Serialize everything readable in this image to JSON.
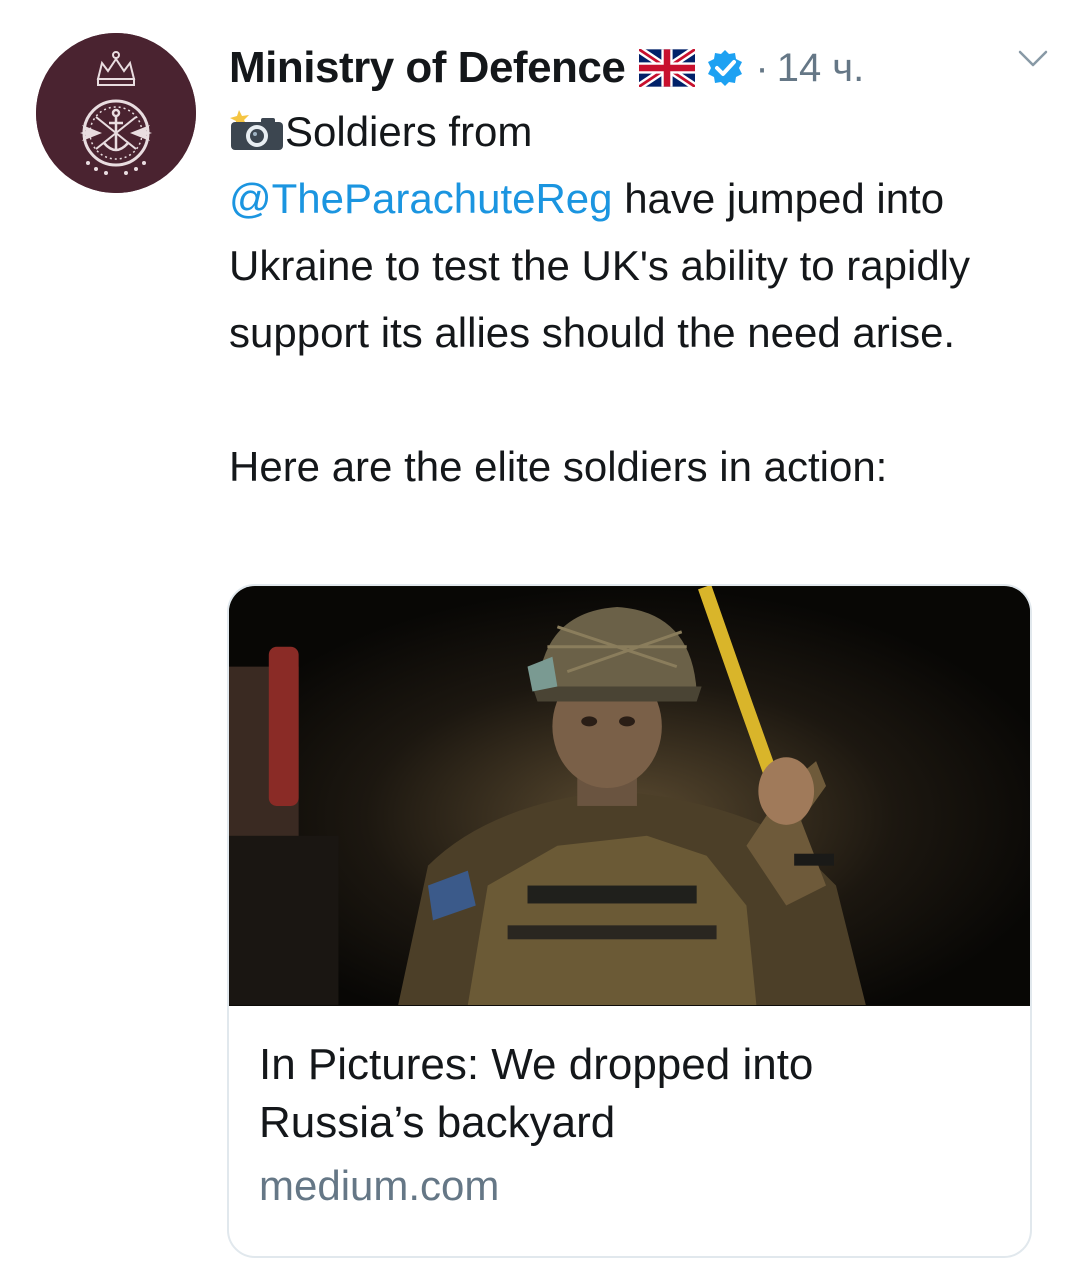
{
  "tweet": {
    "author": "Ministry of Defence",
    "time_separator": "·",
    "timestamp": "14 ч.",
    "lines": {
      "intro": "Soldiers from",
      "mention": "@TheParachuteReg",
      "body": " have jumped into Ukraine to test the UK's ability to rapidly support its allies should the need arise.",
      "followup": "Here are the elite soldiers in action:"
    },
    "icons": {
      "avatar": "ministry-of-defence-crest",
      "flag": "uk-flag-emoji",
      "verified": "verified-badge-icon",
      "camera": "camera-with-flash-emoji",
      "menu": "chevron-down-icon"
    }
  },
  "link_card": {
    "title": "In Pictures: We dropped into Russia’s backyard",
    "domain": "medium.com",
    "image": "paratrooper-in-aircraft-photo"
  },
  "colors": {
    "mention": "#1b95e0",
    "secondary_text": "#657786",
    "avatar_bg": "#4a2330",
    "verified": "#1da1f2",
    "card_border": "#e1e8ed"
  }
}
